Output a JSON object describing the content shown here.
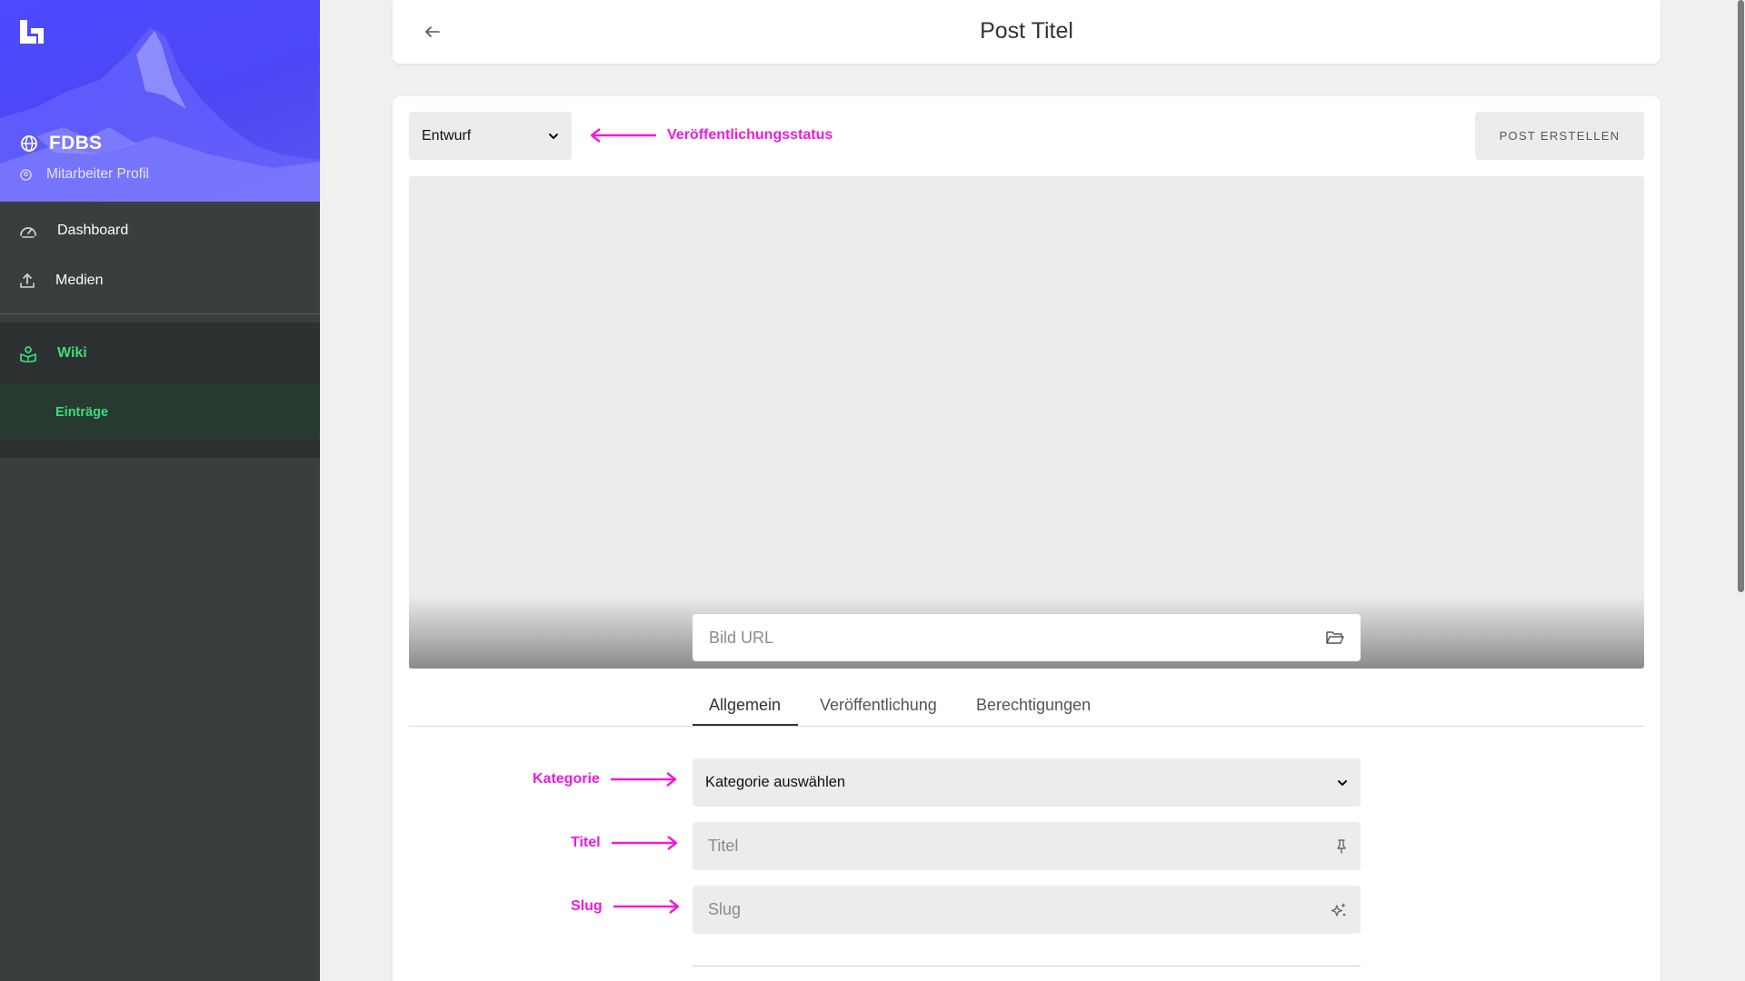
{
  "sidebar": {
    "brand": "FDBS",
    "profile": "Mitarbeiter Profil",
    "nav": [
      {
        "label": "Dashboard",
        "icon": "gauge-icon"
      },
      {
        "label": "Medien",
        "icon": "upload-icon"
      }
    ],
    "wiki": {
      "label": "Wiki",
      "icon": "book-user-icon"
    },
    "wiki_sub": {
      "label": "Einträge"
    }
  },
  "header": {
    "title": "Post Titel"
  },
  "toolbar": {
    "status_value": "Entwurf",
    "create_label": "POST ERSTELLEN"
  },
  "image": {
    "url_placeholder": "Bild URL"
  },
  "tabs": [
    {
      "label": "Allgemein",
      "active": true
    },
    {
      "label": "Veröffentlichung",
      "active": false
    },
    {
      "label": "Berechtigungen",
      "active": false
    }
  ],
  "form": {
    "category_value": "Kategorie auswählen",
    "title_placeholder": "Titel",
    "slug_placeholder": "Slug"
  },
  "annotations": {
    "status": "Veröffentlichungsstatus",
    "category": "Kategorie",
    "title": "Titel",
    "slug": "Slug"
  },
  "colors": {
    "sidebar_header": "#4d4bff",
    "sidebar_bg": "#3a3e3e",
    "accent_green": "#3ddc7a",
    "annotation_magenta": "#f218e0"
  }
}
